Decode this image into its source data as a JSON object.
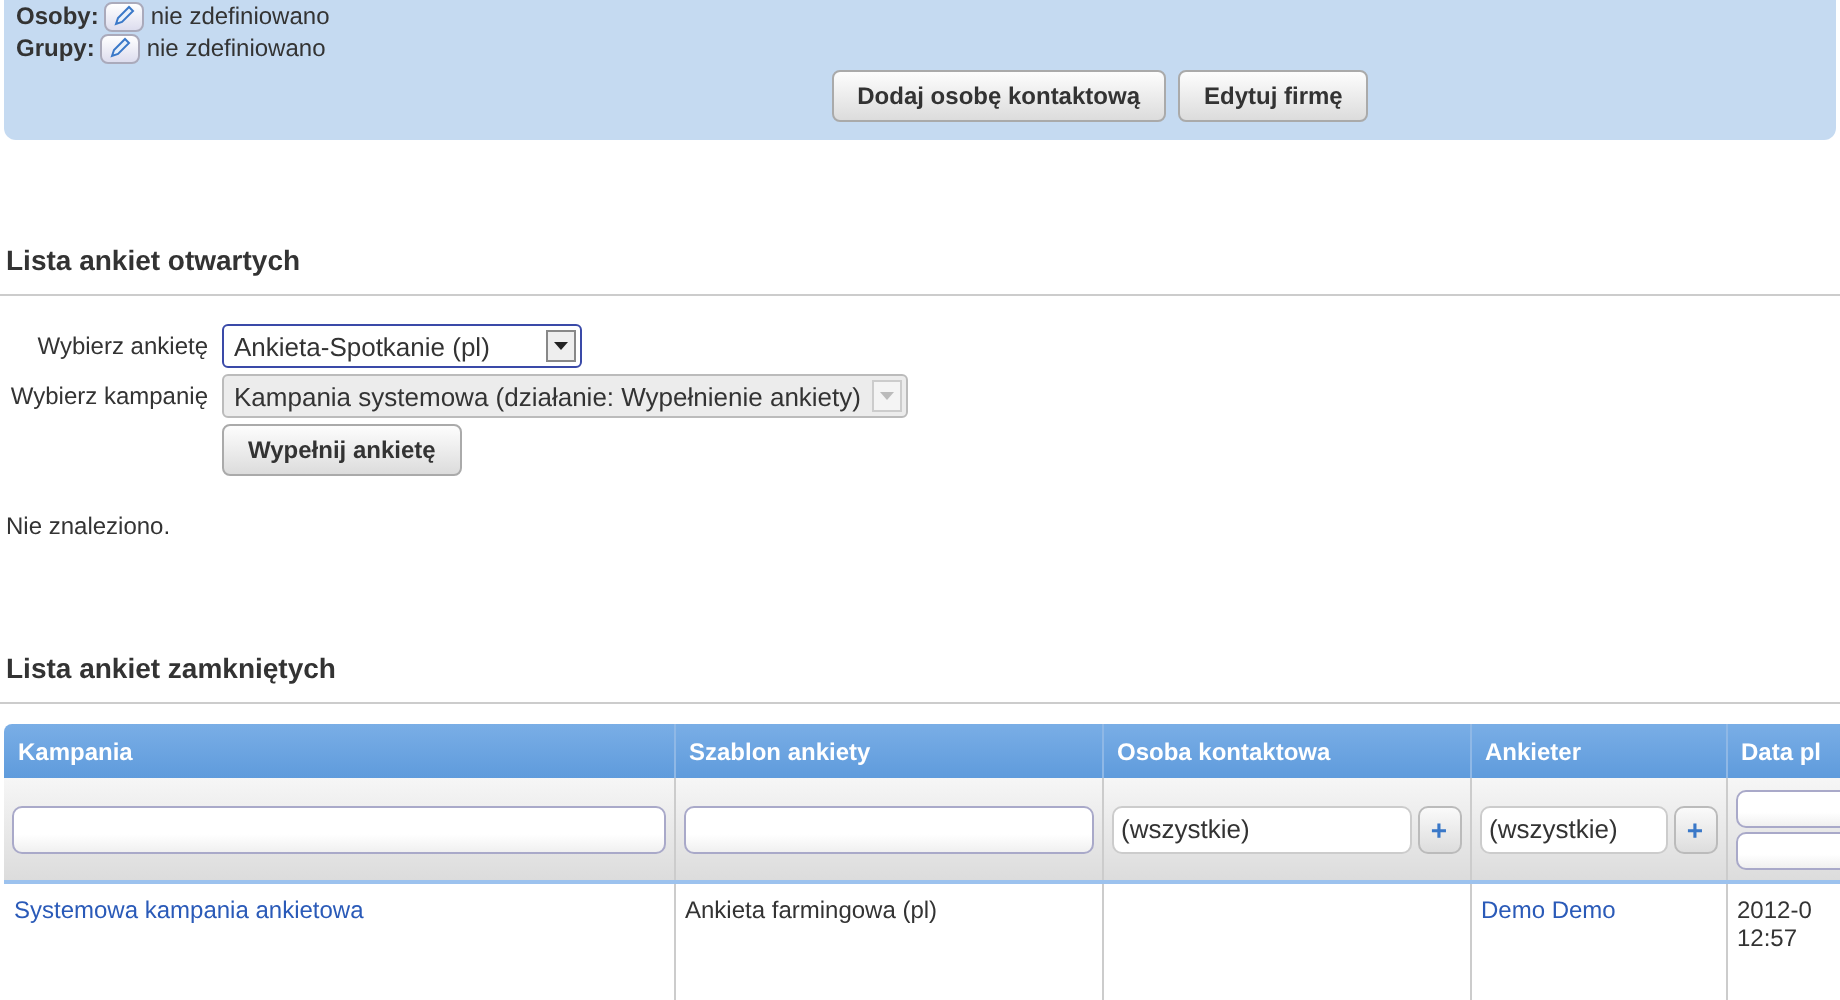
{
  "company_panel": {
    "fields": [
      {
        "label": "Osoby:",
        "value": "nie zdefiniowano"
      },
      {
        "label": "Grupy:",
        "value": "nie zdefiniowano"
      }
    ],
    "buttons": [
      "Dodaj osobę kontaktową",
      "Edytuj firmę"
    ]
  },
  "open_surveys": {
    "title": "Lista ankiet otwartych",
    "selects": [
      {
        "label": "Wybierz ankietę",
        "value": "Ankieta-Spotkanie (pl)",
        "disabled": false
      },
      {
        "label": "Wybierz kampanię",
        "value": "Kampania systemowa (działanie: Wypełnienie ankiety)",
        "disabled": true
      }
    ],
    "button": "Wypełnij ankietę",
    "empty_message": "Nie znaleziono."
  },
  "closed_surveys": {
    "title": "Lista ankiet zamkniętych",
    "table": {
      "columns": [
        {
          "label": "Kampania",
          "kind": "text"
        },
        {
          "label": "Szablon ankiety",
          "kind": "text"
        },
        {
          "label": "Osoba kontaktowa",
          "kind": "picker",
          "value": "(wszystkie)",
          "add_label": "+"
        },
        {
          "label": "Ankieter",
          "kind": "picker",
          "value": "(wszystkie)",
          "add_label": "+"
        },
        {
          "label": "Data pl",
          "kind": "range"
        }
      ],
      "rows": [
        {
          "cells": [
            {
              "text": "Systemowa kampania ankietowa",
              "kind": "link"
            },
            {
              "text": "Ankieta farmingowa (pl)",
              "kind": "text"
            },
            {
              "kind": "empty"
            },
            {
              "text": "Demo Demo",
              "kind": "link"
            },
            {
              "text": "2012-0\n12:57",
              "kind": "text"
            }
          ]
        }
      ]
    }
  }
}
